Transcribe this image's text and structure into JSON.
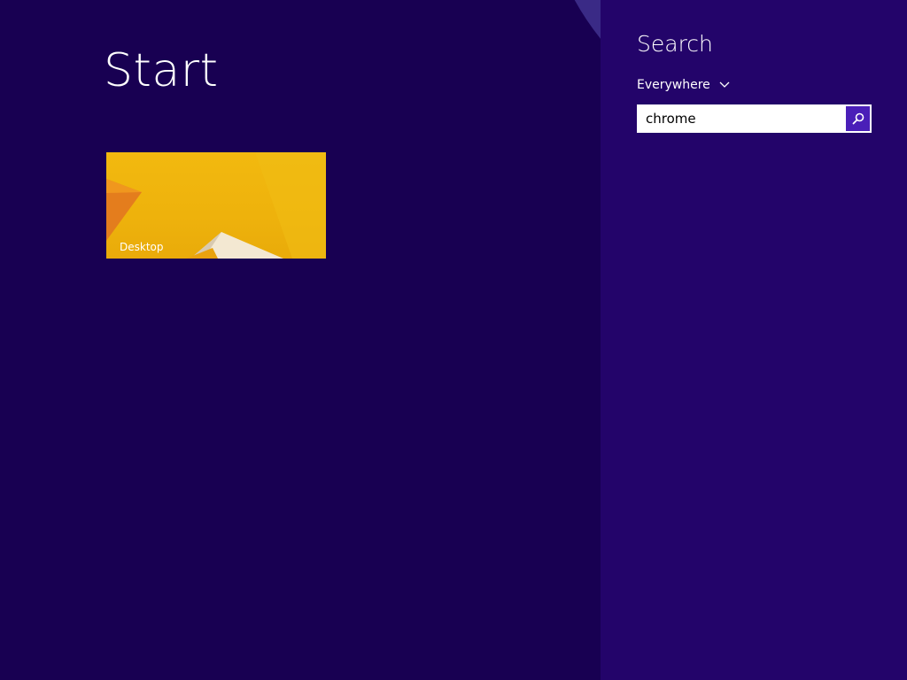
{
  "start": {
    "title": "Start",
    "tiles": [
      {
        "label": "Desktop",
        "icon": "desktop-wallpaper-icon"
      }
    ]
  },
  "search": {
    "title": "Search",
    "scope_label": "Everywhere",
    "scope_icon": "chevron-down-icon",
    "query_value": "chrome",
    "submit_icon": "search-icon"
  },
  "colors": {
    "start_background": "#180052",
    "search_pane_background": "#23046a",
    "accent_circle": "#3a2a86",
    "search_button": "#4a1fb8",
    "desktop_tile": "#f2b90f"
  }
}
